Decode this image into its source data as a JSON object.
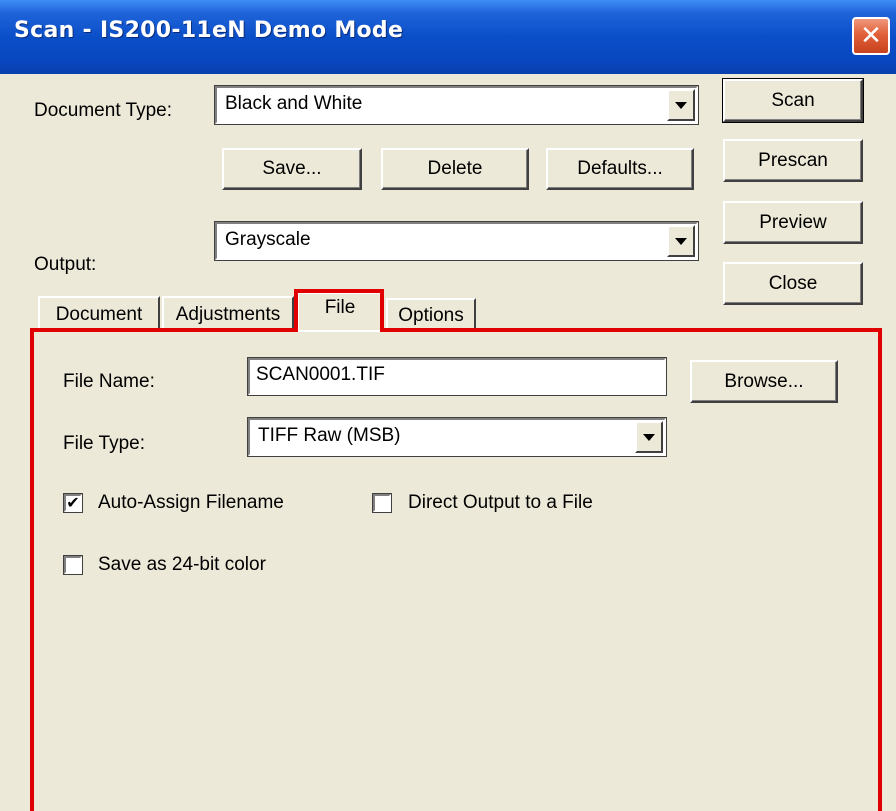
{
  "window": {
    "title": "Scan - IS200-11eN Demo Mode",
    "close_glyph": "✕",
    "close_icon": "close-icon"
  },
  "document_type": {
    "label": "Document Type:",
    "value": "Black and White"
  },
  "buttons": {
    "save": "Save...",
    "delete": "Delete",
    "defaults": "Defaults...",
    "scan": "Scan",
    "prescan": "Prescan",
    "preview": "Preview",
    "close": "Close",
    "browse": "Browse..."
  },
  "output": {
    "label": "Output:",
    "value": "Grayscale"
  },
  "tabs": [
    {
      "label": "Document",
      "active": false
    },
    {
      "label": "Adjustments",
      "active": false
    },
    {
      "label": "File",
      "active": true
    },
    {
      "label": "Options",
      "active": false
    }
  ],
  "file_tab": {
    "file_name_label": "File Name:",
    "file_name_value": "SCAN0001.TIF",
    "file_type_label": "File Type:",
    "file_type_value": "TIFF Raw (MSB)",
    "auto_assign": {
      "label": "Auto-Assign Filename",
      "checked": true
    },
    "direct_output": {
      "label": "Direct Output to a File",
      "checked": false
    },
    "save_24bit": {
      "label": "Save as 24-bit color",
      "checked": false
    }
  },
  "colors": {
    "titlebar": "#0a4fc8",
    "highlight_outline": "#e00000",
    "face": "#ece9d8"
  },
  "check_glyph": "✔"
}
